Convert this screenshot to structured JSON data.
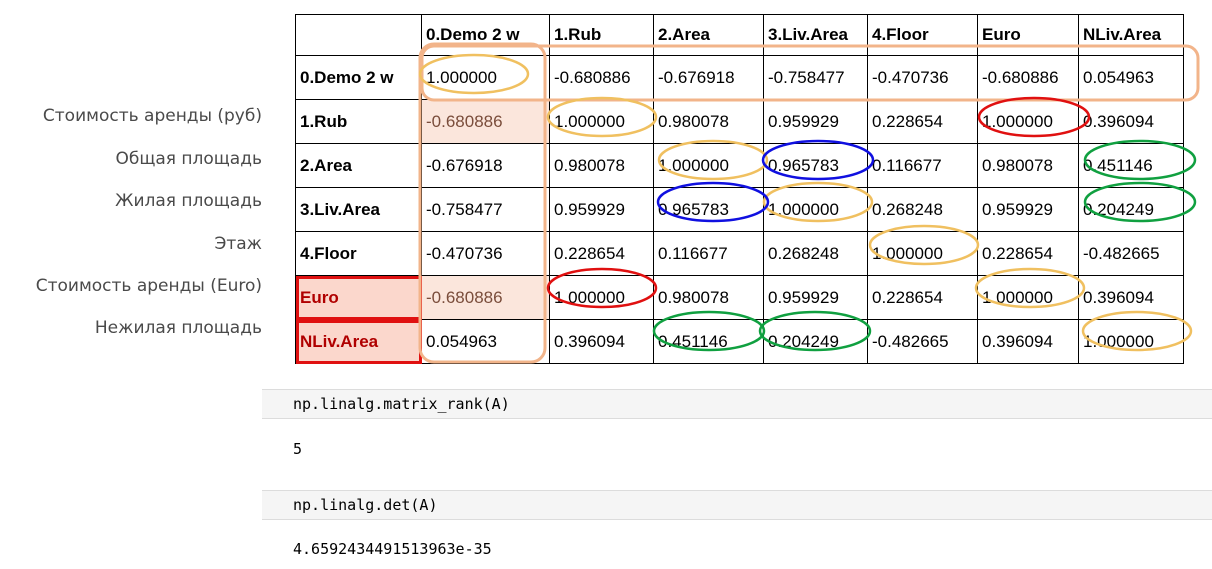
{
  "row_labels": [
    "Стоимость аренды (руб)",
    "Общая площадь",
    "Жилая площадь",
    "Этаж",
    "Стоимость аренды (Euro)",
    "Нежилая площадь"
  ],
  "table": {
    "columns": [
      "",
      "0.Demo 2 w",
      "1.Rub",
      "2.Area",
      "3.Liv.Area",
      "4.Floor",
      "Euro",
      "NLiv.Area"
    ],
    "rows": [
      {
        "name": "0.Demo 2 w",
        "values": [
          "1.000000",
          "-0.680886",
          "-0.676918",
          "-0.758477",
          "-0.470736",
          "-0.680886",
          "0.054963"
        ]
      },
      {
        "name": "1.Rub",
        "values": [
          "-0.680886",
          "1.000000",
          "0.980078",
          "0.959929",
          "0.228654",
          "1.000000",
          "0.396094"
        ]
      },
      {
        "name": "2.Area",
        "values": [
          "-0.676918",
          "0.980078",
          "1.000000",
          "0.965783",
          "0.116677",
          "0.980078",
          "0.451146"
        ]
      },
      {
        "name": "3.Liv.Area",
        "values": [
          "-0.758477",
          "0.959929",
          "0.965783",
          "1.000000",
          "0.268248",
          "0.959929",
          "0.204249"
        ]
      },
      {
        "name": "4.Floor",
        "values": [
          "-0.470736",
          "0.228654",
          "0.116677",
          "0.268248",
          "1.000000",
          "0.228654",
          "-0.482665"
        ]
      },
      {
        "name": "Euro",
        "values": [
          "-0.680886",
          "1.000000",
          "0.980078",
          "0.959929",
          "0.228654",
          "1.000000",
          "0.396094"
        ]
      },
      {
        "name": "NLiv.Area",
        "values": [
          "0.054963",
          "0.396094",
          "0.451146",
          "0.204249",
          "-0.482665",
          "0.396094",
          "1.000000"
        ]
      }
    ]
  },
  "annotation_colors": {
    "diagonal": "#f0c060",
    "rub_euro": "#e01010",
    "area_liv": "#1010e0",
    "nliv": "#10a040",
    "demo_box": "#f2b48a"
  },
  "cells": [
    {
      "code": "np.linalg.matrix_rank(A)",
      "output": "5"
    },
    {
      "code": "np.linalg.det(A)",
      "output": "4.6592434491513963e-35"
    }
  ]
}
